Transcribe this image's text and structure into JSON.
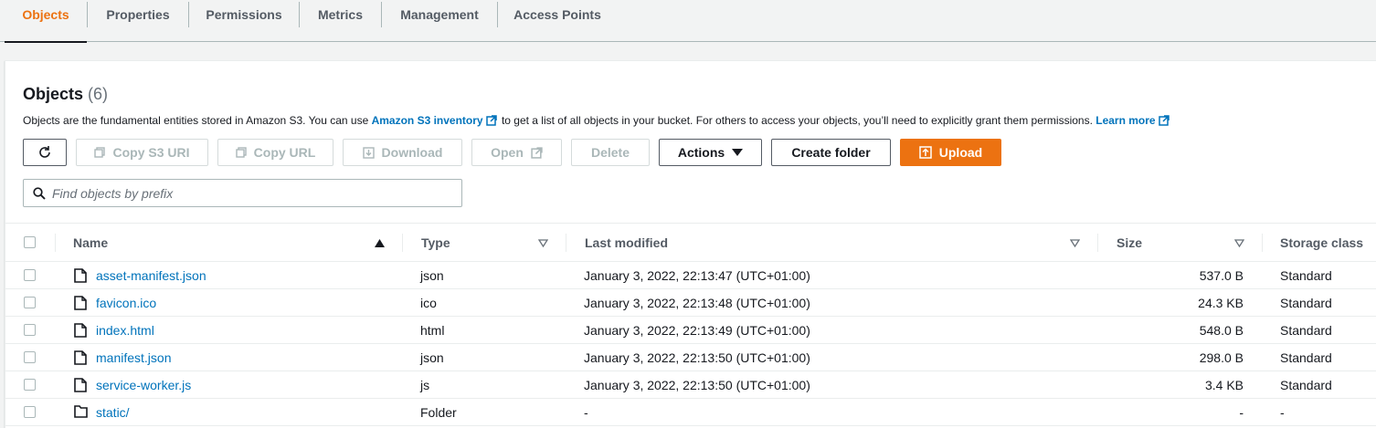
{
  "tabs": [
    "Objects",
    "Properties",
    "Permissions",
    "Metrics",
    "Management",
    "Access Points"
  ],
  "active_tab": "Objects",
  "header": {
    "title": "Objects",
    "count": "(6)",
    "desc_before": "Objects are the fundamental entities stored in Amazon S3. You can use ",
    "inventory_link": "Amazon S3 inventory",
    "desc_middle": " to get a list of all objects in your bucket. For others to access your objects, you’ll need to explicitly grant them permissions. ",
    "learn_more": "Learn more"
  },
  "toolbar": {
    "refresh_icon": "refresh-icon",
    "copy_s3_uri": "Copy S3 URI",
    "copy_url": "Copy URL",
    "download": "Download",
    "open": "Open",
    "delete": "Delete",
    "actions": "Actions",
    "create_folder": "Create folder",
    "upload": "Upload"
  },
  "search": {
    "placeholder": "Find objects by prefix",
    "value": ""
  },
  "table": {
    "columns": [
      "Name",
      "Type",
      "Last modified",
      "Size",
      "Storage class"
    ],
    "rows": [
      {
        "name": "asset-manifest.json",
        "type": "json",
        "modified": "January 3, 2022, 22:13:47 (UTC+01:00)",
        "size": "537.0 B",
        "storage": "Standard",
        "kind": "file"
      },
      {
        "name": "favicon.ico",
        "type": "ico",
        "modified": "January 3, 2022, 22:13:48 (UTC+01:00)",
        "size": "24.3 KB",
        "storage": "Standard",
        "kind": "file"
      },
      {
        "name": "index.html",
        "type": "html",
        "modified": "January 3, 2022, 22:13:49 (UTC+01:00)",
        "size": "548.0 B",
        "storage": "Standard",
        "kind": "file"
      },
      {
        "name": "manifest.json",
        "type": "json",
        "modified": "January 3, 2022, 22:13:50 (UTC+01:00)",
        "size": "298.0 B",
        "storage": "Standard",
        "kind": "file"
      },
      {
        "name": "service-worker.js",
        "type": "js",
        "modified": "January 3, 2022, 22:13:50 (UTC+01:00)",
        "size": "3.4 KB",
        "storage": "Standard",
        "kind": "file"
      },
      {
        "name": "static/",
        "type": "Folder",
        "modified": "-",
        "size": "-",
        "storage": "-",
        "kind": "folder"
      }
    ]
  },
  "colors": {
    "accent": "#ec7211",
    "link": "#0073bb",
    "text": "#16191f",
    "muted": "#545b64"
  }
}
